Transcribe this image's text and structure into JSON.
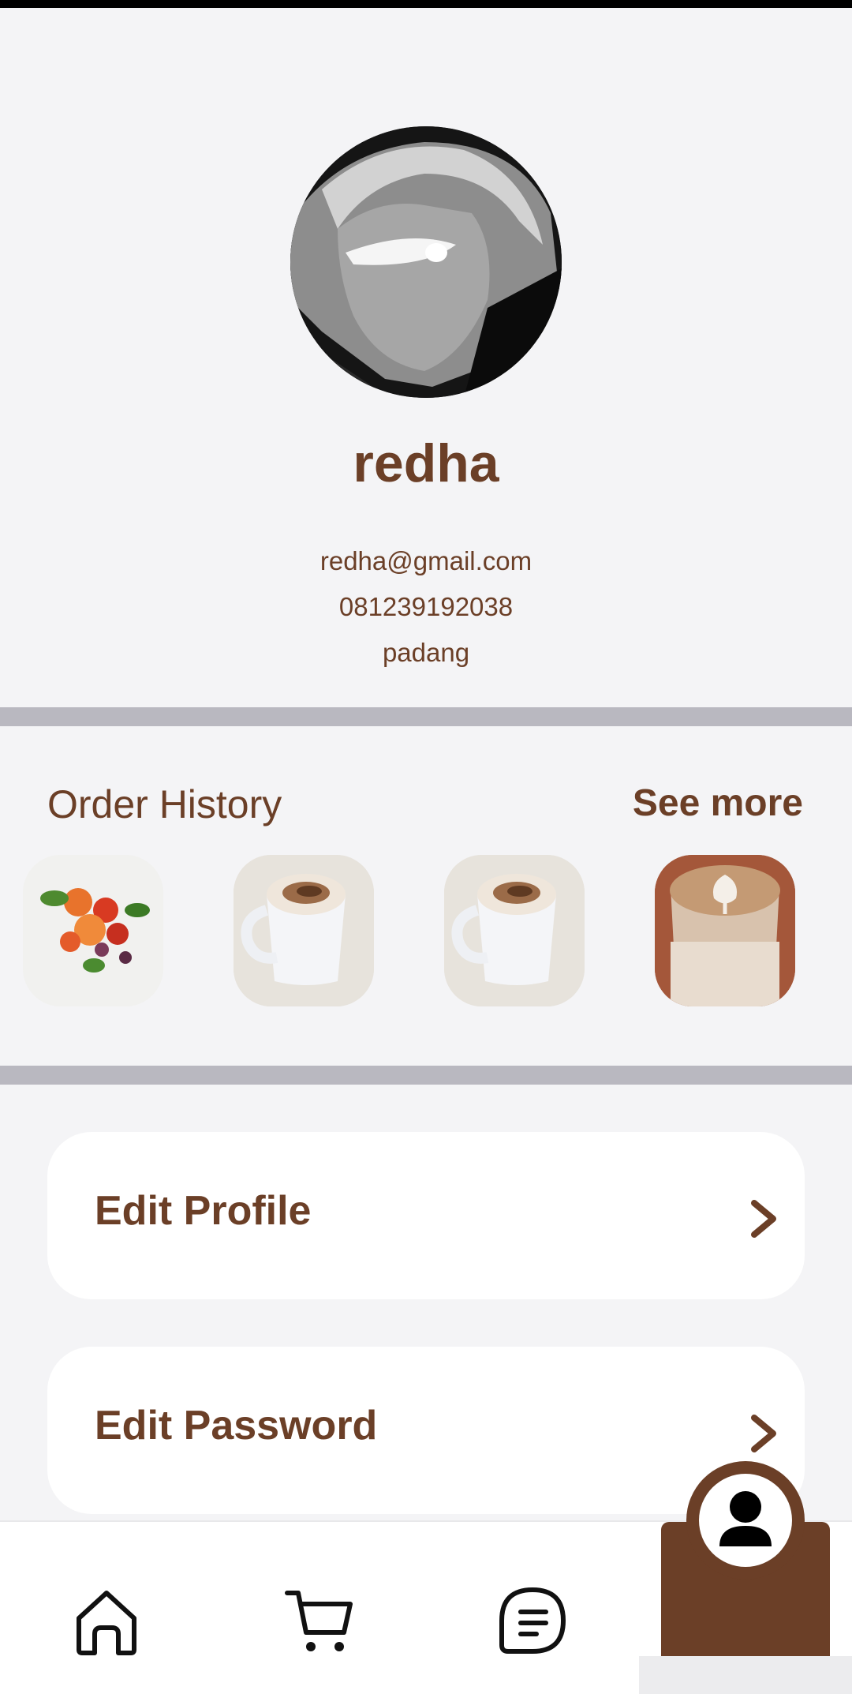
{
  "profile": {
    "name": "redha",
    "email": "redha@gmail.com",
    "phone": "081239192038",
    "city": "padang"
  },
  "order_history": {
    "title": "Order History",
    "see_more": "See more",
    "items": [
      {
        "image": "salad-photo"
      },
      {
        "image": "cappuccino-photo"
      },
      {
        "image": "cappuccino-photo"
      },
      {
        "image": "latte-art-photo"
      }
    ]
  },
  "menu": {
    "edit_profile": "Edit Profile",
    "edit_password": "Edit Password"
  },
  "nav": {
    "items": [
      "home-icon",
      "cart-icon",
      "orders-icon",
      "profile-icon"
    ],
    "active": "profile"
  },
  "colors": {
    "brand": "#6b3f27",
    "background": "#f4f4f6",
    "divider": "#b9b8c0",
    "card": "#ffffff"
  }
}
